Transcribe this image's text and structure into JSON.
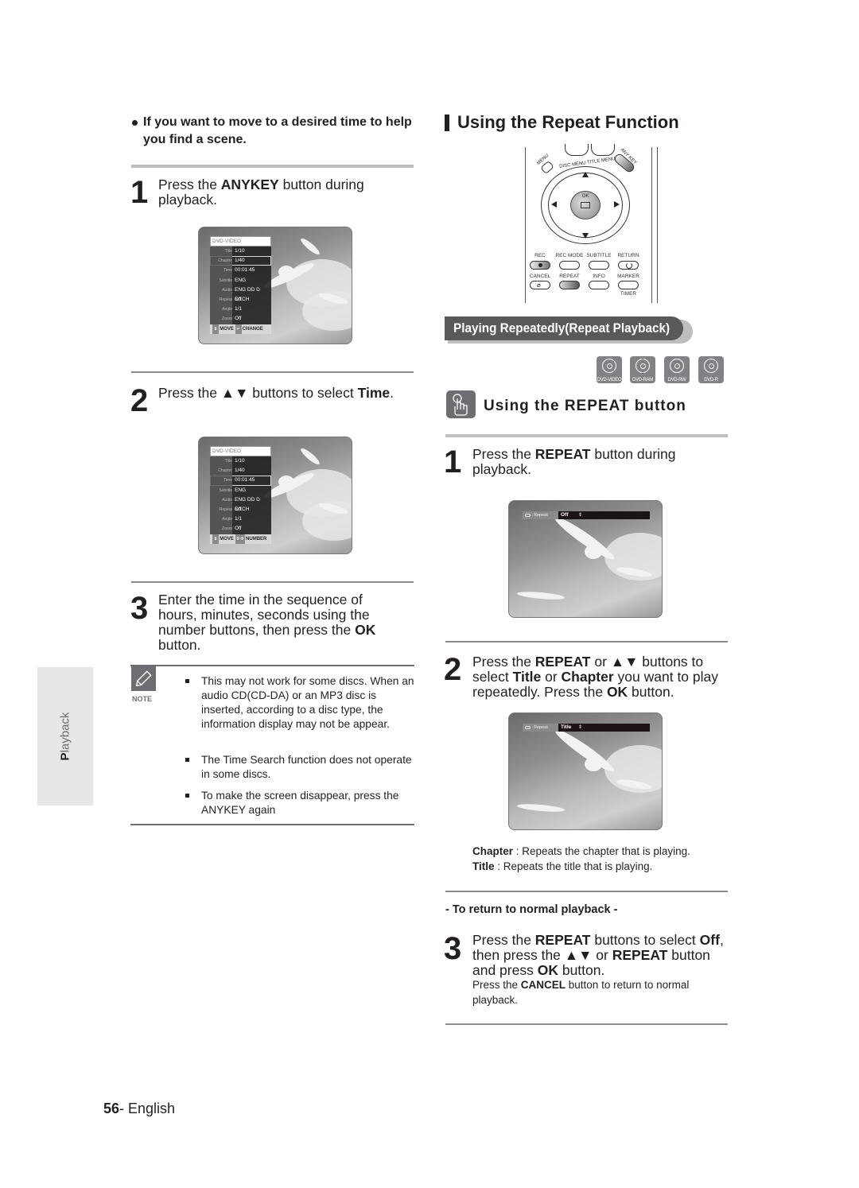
{
  "left": {
    "intro_heading": "If you want to move to a desired time to help you find a scene.",
    "steps": [
      {
        "num": "1",
        "parts": [
          {
            "t": "Press the "
          },
          {
            "b": "ANYKEY"
          },
          {
            "t": " button during playback."
          }
        ]
      },
      {
        "num": "2",
        "parts": [
          {
            "t": "Press the ▲▼ buttons to select "
          },
          {
            "b": "Time"
          },
          {
            "t": "."
          }
        ]
      },
      {
        "num": "3",
        "parts": [
          {
            "t": "Enter the time in the sequence of hours, minutes, seconds using the number buttons, then press the "
          },
          {
            "b": "OK"
          },
          {
            "t": " button."
          }
        ]
      }
    ],
    "osd1": {
      "header": "DVD-VIDEO",
      "rows": [
        {
          "label": "Title",
          "value": "1/10"
        },
        {
          "label": "Chapter",
          "value": "1/40"
        },
        {
          "label": "Time",
          "value": "00:01:45"
        },
        {
          "label": "Subtitle",
          "value": "ENG"
        },
        {
          "label": "Audio",
          "value": "ENG DD D 5.1CH"
        },
        {
          "label": "Repeat",
          "value": "Off"
        },
        {
          "label": "Angle",
          "value": "1/1"
        },
        {
          "label": "Zoom",
          "value": "Off"
        }
      ],
      "selected": "Chapter",
      "footer_move": "MOVE",
      "footer_action": "CHANGE"
    },
    "osd2": {
      "header": "DVD-VIDEO",
      "rows": [
        {
          "label": "Title",
          "value": "1/10"
        },
        {
          "label": "Chapter",
          "value": "1/40"
        },
        {
          "label": "Time",
          "value": "00:01:45"
        },
        {
          "label": "Subtitle",
          "value": "ENG"
        },
        {
          "label": "Audio",
          "value": "ENG DD D 5.1CH"
        },
        {
          "label": "Repeat",
          "value": "Off"
        },
        {
          "label": "Angle",
          "value": "1/1"
        },
        {
          "label": "Zoom",
          "value": "Off"
        }
      ],
      "selected": "Time",
      "footer_move": "MOVE",
      "footer_key": "0~9",
      "footer_action": "NUMBER"
    },
    "note": {
      "label": "NOTE",
      "items": [
        "This may not work for some discs. When an audio CD(CD-DA) or an MP3 disc is inserted, according to a disc type, the information display may not be appear.",
        "The Time Search function does not operate in some discs.",
        "To make the screen disappear, press the ANYKEY again"
      ]
    },
    "side_tab": "Playback"
  },
  "right": {
    "section_title": "Using the Repeat Function",
    "remote": {
      "menu": "MENU",
      "disc_menu": "DISC MENU",
      "title_menu": "TITLE MENU",
      "anykey": "ANY KEY",
      "ok": "OK",
      "row1": [
        "REC",
        "REC MODE",
        "SUBTITLE",
        "RETURN"
      ],
      "row2": [
        "CANCEL",
        "REPEAT",
        "INFO",
        "MARKER"
      ],
      "timer": "TIMER"
    },
    "banner": "Playing Repeatedly(Repeat Playback)",
    "discs": [
      "DVD-VIDEO",
      "DVD-RAM",
      "DVD-RW",
      "DVD-R"
    ],
    "subheading": "Using the REPEAT button",
    "steps": [
      {
        "num": "1",
        "parts": [
          {
            "t": "Press the "
          },
          {
            "b": "REPEAT"
          },
          {
            "t": " button during playback."
          }
        ]
      },
      {
        "num": "2",
        "parts": [
          {
            "t": "Press the "
          },
          {
            "b": "REPEAT"
          },
          {
            "t": " or ▲▼ buttons to select "
          },
          {
            "b": "Title"
          },
          {
            "t": " or "
          },
          {
            "b": "Chapter"
          },
          {
            "t": " you want to play repeatedly. Press the "
          },
          {
            "b": "OK"
          },
          {
            "t": " button."
          }
        ]
      },
      {
        "num": "3",
        "parts": [
          {
            "t": "Press the "
          },
          {
            "b": "REPEAT"
          },
          {
            "t": " buttons to select "
          },
          {
            "b": "Off"
          },
          {
            "t": ", then press the ▲▼ or "
          },
          {
            "b": "REPEAT"
          },
          {
            "t": " button and press "
          },
          {
            "b": "OK"
          },
          {
            "t": " button."
          }
        ]
      }
    ],
    "osd_repeat1": {
      "label": "Repeat",
      "value": "Off"
    },
    "osd_repeat2": {
      "label": "Repeat",
      "value": "Title"
    },
    "definitions": [
      {
        "term": "Chapter",
        "desc": " : Repeats the chapter that is playing."
      },
      {
        "term": "Title",
        "desc": " : Repeats the title that is playing."
      }
    ],
    "return_heading": "- To return to normal playback -",
    "cancel_note": [
      {
        "t": "Press the "
      },
      {
        "b": "CANCEL"
      },
      {
        "t": " button to return to normal playback."
      }
    ]
  },
  "footer": {
    "page_number": "56",
    "language": "- English"
  }
}
